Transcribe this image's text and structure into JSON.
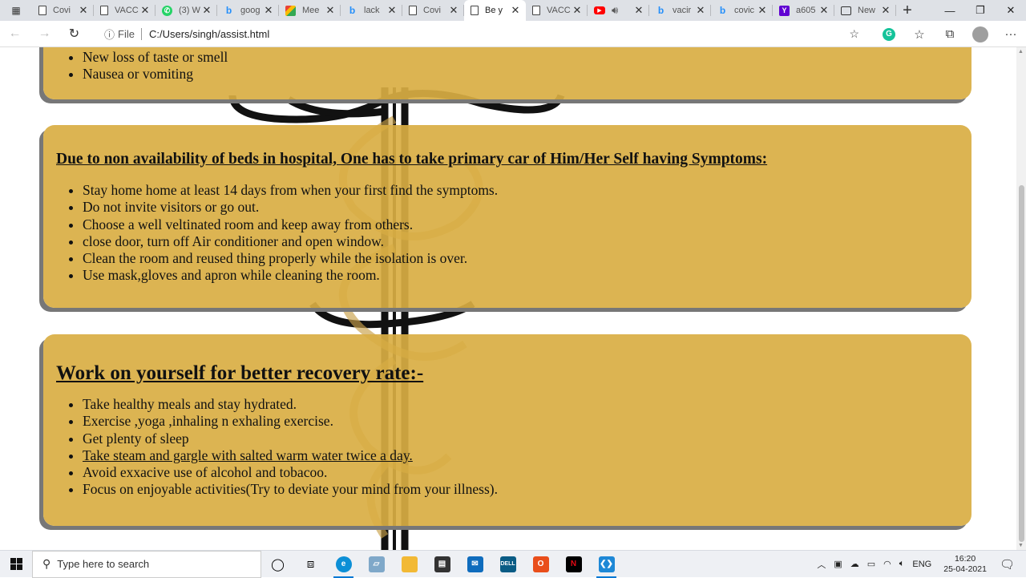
{
  "browser": {
    "tabs": [
      {
        "label": "Covi",
        "icon": "document-icon",
        "active": false
      },
      {
        "label": "VACC",
        "icon": "document-icon",
        "active": false
      },
      {
        "label": "(3) W",
        "icon": "whatsapp-icon",
        "active": false
      },
      {
        "label": "goog",
        "icon": "bing-icon",
        "active": false
      },
      {
        "label": "Mee",
        "icon": "meet-icon",
        "active": false
      },
      {
        "label": "lack",
        "icon": "bing-icon",
        "active": false
      },
      {
        "label": "Covi",
        "icon": "document-icon",
        "active": false
      },
      {
        "label": "Be y",
        "icon": "document-icon",
        "active": true
      },
      {
        "label": "VACC",
        "icon": "document-icon",
        "active": false
      },
      {
        "label": "",
        "icon": "youtube-icon",
        "active": false
      },
      {
        "label": "vacir",
        "icon": "bing-icon",
        "active": false
      },
      {
        "label": "covic",
        "icon": "bing-icon",
        "active": false
      },
      {
        "label": "a605",
        "icon": "yahoo-icon",
        "active": false
      },
      {
        "label": "New",
        "icon": "newtab-icon",
        "active": false
      }
    ],
    "address": {
      "scheme": "File",
      "url": "C:/Users/singh/assist.html"
    }
  },
  "page": {
    "card1": {
      "items": [
        "New loss of taste or smell",
        "Nausea or vomiting"
      ]
    },
    "card2": {
      "heading": "Due to non availability of beds in hospital, One has to take primary car of Him/Her Self having Symptoms:",
      "items": [
        "Stay home home at least 14 days from when your first find the symptoms.",
        "Do not invite visitors or go out.",
        "Choose a well veltinated room and keep away from others.",
        "close door, turn off Air conditioner and open window.",
        "Clean the room and reused thing properly while the isolation is over.",
        "Use mask,gloves and apron while cleaning the room."
      ]
    },
    "card3": {
      "heading": "Work on yourself for better recovery rate:-",
      "items": [
        "Take healthy meals and stay hydrated.",
        "Exercise ,yoga ,inhaling n exhaling exercise.",
        "Get plenty of sleep",
        "Take steam and gargle with salted warm water twice a day.",
        "Avoid exxacive use of alcohol and tobacoo.",
        "Focus on enjoyable activities(Try to deviate your mind from your illness)."
      ]
    }
  },
  "taskbar": {
    "search_placeholder": "Type here to search",
    "language": "ENG",
    "time": "16:20",
    "date": "25-04-2021"
  },
  "colors": {
    "card_bg": "#d9ae43",
    "card_shadow": "#777777"
  }
}
